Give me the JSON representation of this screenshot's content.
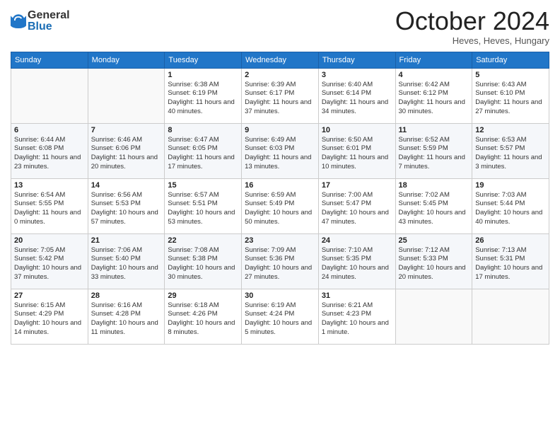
{
  "logo": {
    "general": "General",
    "blue": "Blue"
  },
  "title": "October 2024",
  "location": "Heves, Heves, Hungary",
  "weekdays": [
    "Sunday",
    "Monday",
    "Tuesday",
    "Wednesday",
    "Thursday",
    "Friday",
    "Saturday"
  ],
  "weeks": [
    [
      {
        "day": "",
        "sunrise": "",
        "sunset": "",
        "daylight": ""
      },
      {
        "day": "",
        "sunrise": "",
        "sunset": "",
        "daylight": ""
      },
      {
        "day": "1",
        "sunrise": "Sunrise: 6:38 AM",
        "sunset": "Sunset: 6:19 PM",
        "daylight": "Daylight: 11 hours and 40 minutes."
      },
      {
        "day": "2",
        "sunrise": "Sunrise: 6:39 AM",
        "sunset": "Sunset: 6:17 PM",
        "daylight": "Daylight: 11 hours and 37 minutes."
      },
      {
        "day": "3",
        "sunrise": "Sunrise: 6:40 AM",
        "sunset": "Sunset: 6:14 PM",
        "daylight": "Daylight: 11 hours and 34 minutes."
      },
      {
        "day": "4",
        "sunrise": "Sunrise: 6:42 AM",
        "sunset": "Sunset: 6:12 PM",
        "daylight": "Daylight: 11 hours and 30 minutes."
      },
      {
        "day": "5",
        "sunrise": "Sunrise: 6:43 AM",
        "sunset": "Sunset: 6:10 PM",
        "daylight": "Daylight: 11 hours and 27 minutes."
      }
    ],
    [
      {
        "day": "6",
        "sunrise": "Sunrise: 6:44 AM",
        "sunset": "Sunset: 6:08 PM",
        "daylight": "Daylight: 11 hours and 23 minutes."
      },
      {
        "day": "7",
        "sunrise": "Sunrise: 6:46 AM",
        "sunset": "Sunset: 6:06 PM",
        "daylight": "Daylight: 11 hours and 20 minutes."
      },
      {
        "day": "8",
        "sunrise": "Sunrise: 6:47 AM",
        "sunset": "Sunset: 6:05 PM",
        "daylight": "Daylight: 11 hours and 17 minutes."
      },
      {
        "day": "9",
        "sunrise": "Sunrise: 6:49 AM",
        "sunset": "Sunset: 6:03 PM",
        "daylight": "Daylight: 11 hours and 13 minutes."
      },
      {
        "day": "10",
        "sunrise": "Sunrise: 6:50 AM",
        "sunset": "Sunset: 6:01 PM",
        "daylight": "Daylight: 11 hours and 10 minutes."
      },
      {
        "day": "11",
        "sunrise": "Sunrise: 6:52 AM",
        "sunset": "Sunset: 5:59 PM",
        "daylight": "Daylight: 11 hours and 7 minutes."
      },
      {
        "day": "12",
        "sunrise": "Sunrise: 6:53 AM",
        "sunset": "Sunset: 5:57 PM",
        "daylight": "Daylight: 11 hours and 3 minutes."
      }
    ],
    [
      {
        "day": "13",
        "sunrise": "Sunrise: 6:54 AM",
        "sunset": "Sunset: 5:55 PM",
        "daylight": "Daylight: 11 hours and 0 minutes."
      },
      {
        "day": "14",
        "sunrise": "Sunrise: 6:56 AM",
        "sunset": "Sunset: 5:53 PM",
        "daylight": "Daylight: 10 hours and 57 minutes."
      },
      {
        "day": "15",
        "sunrise": "Sunrise: 6:57 AM",
        "sunset": "Sunset: 5:51 PM",
        "daylight": "Daylight: 10 hours and 53 minutes."
      },
      {
        "day": "16",
        "sunrise": "Sunrise: 6:59 AM",
        "sunset": "Sunset: 5:49 PM",
        "daylight": "Daylight: 10 hours and 50 minutes."
      },
      {
        "day": "17",
        "sunrise": "Sunrise: 7:00 AM",
        "sunset": "Sunset: 5:47 PM",
        "daylight": "Daylight: 10 hours and 47 minutes."
      },
      {
        "day": "18",
        "sunrise": "Sunrise: 7:02 AM",
        "sunset": "Sunset: 5:45 PM",
        "daylight": "Daylight: 10 hours and 43 minutes."
      },
      {
        "day": "19",
        "sunrise": "Sunrise: 7:03 AM",
        "sunset": "Sunset: 5:44 PM",
        "daylight": "Daylight: 10 hours and 40 minutes."
      }
    ],
    [
      {
        "day": "20",
        "sunrise": "Sunrise: 7:05 AM",
        "sunset": "Sunset: 5:42 PM",
        "daylight": "Daylight: 10 hours and 37 minutes."
      },
      {
        "day": "21",
        "sunrise": "Sunrise: 7:06 AM",
        "sunset": "Sunset: 5:40 PM",
        "daylight": "Daylight: 10 hours and 33 minutes."
      },
      {
        "day": "22",
        "sunrise": "Sunrise: 7:08 AM",
        "sunset": "Sunset: 5:38 PM",
        "daylight": "Daylight: 10 hours and 30 minutes."
      },
      {
        "day": "23",
        "sunrise": "Sunrise: 7:09 AM",
        "sunset": "Sunset: 5:36 PM",
        "daylight": "Daylight: 10 hours and 27 minutes."
      },
      {
        "day": "24",
        "sunrise": "Sunrise: 7:10 AM",
        "sunset": "Sunset: 5:35 PM",
        "daylight": "Daylight: 10 hours and 24 minutes."
      },
      {
        "day": "25",
        "sunrise": "Sunrise: 7:12 AM",
        "sunset": "Sunset: 5:33 PM",
        "daylight": "Daylight: 10 hours and 20 minutes."
      },
      {
        "day": "26",
        "sunrise": "Sunrise: 7:13 AM",
        "sunset": "Sunset: 5:31 PM",
        "daylight": "Daylight: 10 hours and 17 minutes."
      }
    ],
    [
      {
        "day": "27",
        "sunrise": "Sunrise: 6:15 AM",
        "sunset": "Sunset: 4:29 PM",
        "daylight": "Daylight: 10 hours and 14 minutes."
      },
      {
        "day": "28",
        "sunrise": "Sunrise: 6:16 AM",
        "sunset": "Sunset: 4:28 PM",
        "daylight": "Daylight: 10 hours and 11 minutes."
      },
      {
        "day": "29",
        "sunrise": "Sunrise: 6:18 AM",
        "sunset": "Sunset: 4:26 PM",
        "daylight": "Daylight: 10 hours and 8 minutes."
      },
      {
        "day": "30",
        "sunrise": "Sunrise: 6:19 AM",
        "sunset": "Sunset: 4:24 PM",
        "daylight": "Daylight: 10 hours and 5 minutes."
      },
      {
        "day": "31",
        "sunrise": "Sunrise: 6:21 AM",
        "sunset": "Sunset: 4:23 PM",
        "daylight": "Daylight: 10 hours and 1 minute."
      },
      {
        "day": "",
        "sunrise": "",
        "sunset": "",
        "daylight": ""
      },
      {
        "day": "",
        "sunrise": "",
        "sunset": "",
        "daylight": ""
      }
    ]
  ]
}
